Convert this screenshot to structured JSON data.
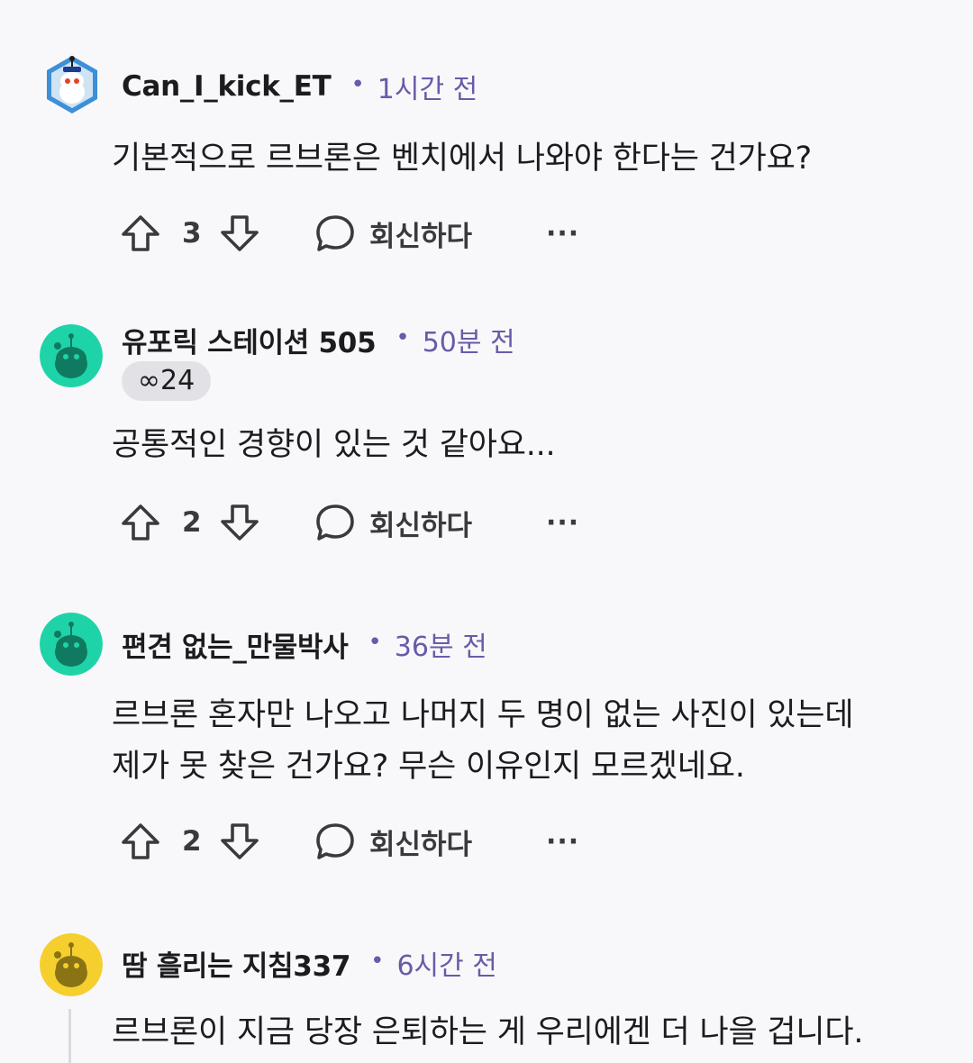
{
  "comments": [
    {
      "username": "Can_I_kick_ET",
      "separator": "•",
      "time": "1시간 전",
      "flair": "",
      "body_lines": [
        "기본적으로 르브론은 벤치에서 나와야 한다는 건가요?"
      ],
      "votes": "3",
      "reply_label": "회신하다",
      "more": "···",
      "avatar_color": "#3d8fd6"
    },
    {
      "username": "유포릭 스테이션 505",
      "separator": "•",
      "time": "50분 전",
      "flair": "∞24",
      "body_lines": [
        "공통적인 경향이 있는 것 같아요..."
      ],
      "votes": "2",
      "reply_label": "회신하다",
      "more": "···",
      "avatar_color": "#1fd3a8"
    },
    {
      "username": "편견 없는_만물박사",
      "separator": "•",
      "time": "36분 전",
      "flair": "",
      "body_lines": [
        "르브론 혼자만 나오고 나머지 두 명이 없는 사진이 있는데",
        "제가 못 찾은 건가요? 무슨 이유인지 모르겠네요."
      ],
      "votes": "2",
      "reply_label": "회신하다",
      "more": "···",
      "avatar_color": "#1fd3a8"
    },
    {
      "username": "땀 흘리는 지침337",
      "separator": "•",
      "time": "6시간 전",
      "flair": "",
      "body_lines": [
        "르브론이 지금 당장 은퇴하는 게 우리에겐 더 나을 겁니다."
      ],
      "votes": "",
      "reply_label": "",
      "more": "",
      "avatar_color": "#f5cf2e"
    }
  ],
  "icons": {
    "upvote": "arrow-up-icon",
    "downvote": "arrow-down-icon",
    "reply": "chat-bubble-icon",
    "more": "ellipsis-icon"
  },
  "colors": {
    "background": "#f8f8fb",
    "meta_purple": "#6a5aa8",
    "text": "#1c1c1e",
    "flair_bg": "#e2e2e6"
  }
}
